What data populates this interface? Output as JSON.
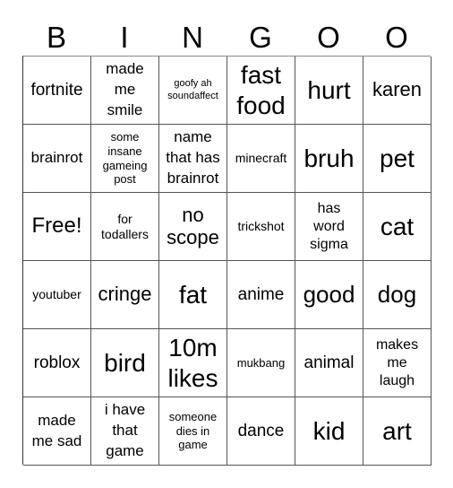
{
  "header": {
    "letters": [
      "B",
      "I",
      "N",
      "G",
      "O",
      "O"
    ]
  },
  "cells": [
    [
      "fortnite",
      "made me smile",
      "goofy ah soundaffect",
      "fast food",
      "hurt",
      "karen"
    ],
    [
      "brainrot",
      "some insane gameing post",
      "name that has brainrot",
      "minecraft",
      "bruh",
      "pet"
    ],
    [
      "Free!",
      "for todallers",
      "no scope",
      "trickshot",
      "has word sigma",
      "cat"
    ],
    [
      "youtuber",
      "cringe",
      "fat",
      "anime",
      "good",
      "dog"
    ],
    [
      "roblox",
      "bird",
      "10m likes",
      "mukbang",
      "animal",
      "makes me laugh"
    ],
    [
      "made me sad",
      "i have that game",
      "someone dies in game",
      "dance",
      "kid",
      "art"
    ]
  ]
}
